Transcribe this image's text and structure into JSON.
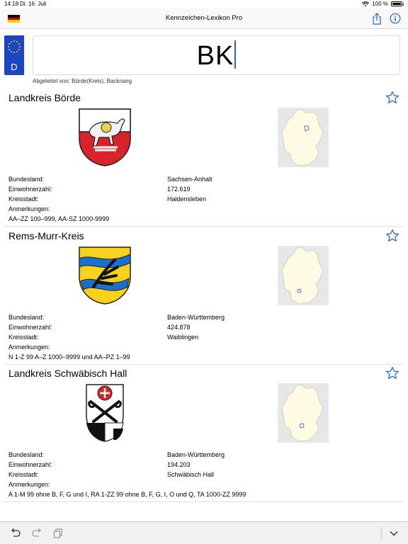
{
  "status": {
    "time": "14:18",
    "date": "Di. 16. Juli",
    "battery": "100 %",
    "battery_level": 1.0
  },
  "nav": {
    "title": "Kennzeichen-Lexikon Pro"
  },
  "plate": {
    "country": "D",
    "text": "BK"
  },
  "derived": "Abgeleitet von: Börde(Kreis), Backnang",
  "labels": {
    "state": "Bundesland:",
    "population": "Einwohnerzahl:",
    "seat": "Kreisstadt:",
    "notes": "Anmerkungen:"
  },
  "entries": [
    {
      "title": "Landkreis Börde",
      "state": "Sachsen-Anhalt",
      "population": "172.619",
      "seat": "Haldensleben",
      "notes": "AA–ZZ 100–999, AA-SZ 1000-9999"
    },
    {
      "title": "Rems-Murr-Kreis",
      "state": "Baden-Württemberg",
      "population": "424.878",
      "seat": "Waiblingen",
      "notes": "N 1-Z 99 A–Z 1000–9999 und AA–PZ 1–99"
    },
    {
      "title": "Landkreis Schwäbisch Hall",
      "state": "Baden-Württemberg",
      "population": "194.203",
      "seat": "Schwäbisch Hall",
      "notes": "A 1-M 99 ohne B, F, G und I, RA 1-ZZ 99 ohne B, F, G, I, O und Q, TA 1000-ZZ 9999"
    }
  ],
  "colors": {
    "accent": "#1e63e6",
    "eu_blue": "#1a47c1",
    "coat_red": "#d8232a",
    "coat_yellow": "#f6d21d",
    "coat_blue": "#1a6fcf"
  },
  "icons": {
    "share": "share-icon",
    "info": "info-icon",
    "star": "star-outline-icon",
    "undo": "undo-icon",
    "redo": "redo-icon",
    "paste": "paste-icon",
    "dismiss": "chevron-down-icon"
  }
}
